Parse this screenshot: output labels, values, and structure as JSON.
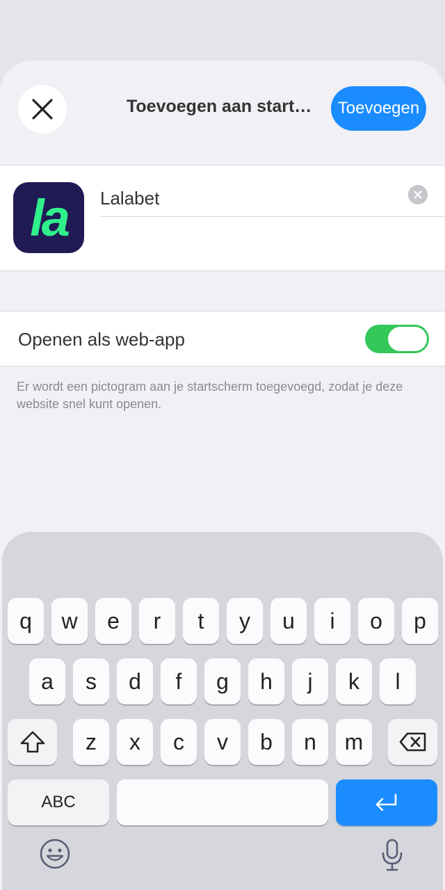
{
  "sheet": {
    "title": "Toevoegen aan startscherm",
    "add_label": "Toevoegen",
    "close_icon": "close-icon"
  },
  "app": {
    "icon_text": "la",
    "name_value": "Lalabet",
    "icon_bg": "#201a55",
    "icon_fg": "#2ff08a"
  },
  "webapp": {
    "label": "Openen als web-app",
    "enabled": true,
    "footnote": "Er wordt een pictogram aan je startscherm toegevoegd, zodat je deze website snel kunt openen."
  },
  "keyboard": {
    "row1": [
      "q",
      "w",
      "e",
      "r",
      "t",
      "y",
      "u",
      "i",
      "o",
      "p"
    ],
    "row2": [
      "a",
      "s",
      "d",
      "f",
      "g",
      "h",
      "j",
      "k",
      "l"
    ],
    "row3": [
      "z",
      "x",
      "c",
      "v",
      "b",
      "n",
      "m"
    ],
    "abc_label": "ABC",
    "icons": [
      "shift-icon",
      "backspace-icon",
      "return-icon",
      "emoji-icon",
      "microphone-icon"
    ]
  },
  "colors": {
    "accent": "#1a8cff",
    "toggle_on": "#34c759"
  }
}
